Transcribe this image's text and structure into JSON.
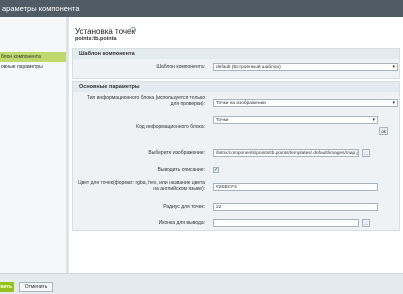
{
  "window": {
    "title": "араметры компонента"
  },
  "sidebar": {
    "items": [
      {
        "label": "блон компонента"
      },
      {
        "label": "овные параметры"
      }
    ]
  },
  "header": {
    "title": "Установка точек",
    "info_icon": "i",
    "subtitle": "points:tb.pointa"
  },
  "sections": {
    "template": {
      "title": "Шаблон компонента",
      "template_label": "Шаблон компонента:",
      "template_value": "default (Встроенный шаблон)"
    },
    "main": {
      "title": "Основные параметры",
      "iblock_type_label": "Тип информационного блока (используется только для проверки):",
      "iblock_type_value": "Точки на изображении",
      "iblock_code_label": "Код информационного блока:",
      "iblock_code_value": "Точки",
      "ok_label": "ok",
      "image_label": "Выберите изображение:",
      "image_value": "/bitrix/components/points/tb.points/templates/.default/images/map.jpg",
      "browse_label": "...",
      "show_desc_label": "Выводить описание:",
      "show_desc_checked": true,
      "check_glyph": "✓",
      "color_label": "Цвет для точек(формат: rgba, hex, или название цвета на английском языке):",
      "color_value": "#2EBCF4",
      "radius_label": "Радиус для точек:",
      "radius_value": "22",
      "icon_label": "Иконка для вывода:",
      "icon_value": "",
      "icon_browse": "..."
    }
  },
  "footer": {
    "save_label": "вить",
    "cancel_label": "Отменить"
  },
  "colors": {
    "titlebar": "#4f5c65",
    "accent": "#94c11f",
    "sidebar_active": "#bfd96f"
  }
}
